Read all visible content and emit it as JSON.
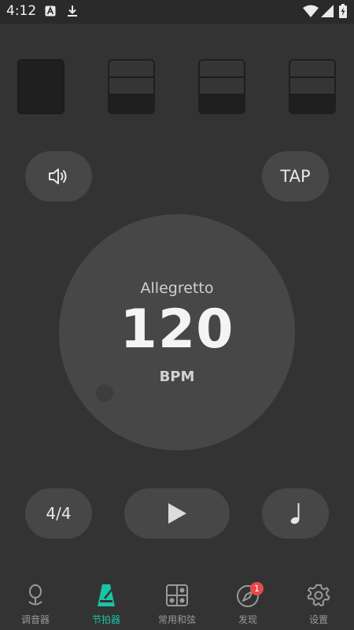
{
  "status_bar": {
    "time": "4:12",
    "icons": [
      "app-notification-icon",
      "download-icon",
      "wifi-icon",
      "cellular-signal-icon",
      "battery-charging-icon"
    ]
  },
  "beats": [
    {
      "state": "accent"
    },
    {
      "state": "normal"
    },
    {
      "state": "normal"
    },
    {
      "state": "normal"
    }
  ],
  "controls": {
    "sound_icon": "speaker-icon",
    "tap_label": "TAP",
    "time_signature": "4/4",
    "play_icon": "play-icon",
    "note_icon": "quarter-note-icon"
  },
  "dial": {
    "tempo_name": "Allegretto",
    "bpm": "120",
    "unit": "BPM"
  },
  "tab_bar": {
    "accent_color": "#19c4a3",
    "tabs": [
      {
        "label": "调音器",
        "icon": "tuner-icon",
        "active": false
      },
      {
        "label": "节拍器",
        "icon": "metronome-icon",
        "active": true
      },
      {
        "label": "常用和弦",
        "icon": "chord-grid-icon",
        "active": false
      },
      {
        "label": "发现",
        "icon": "compass-icon",
        "active": false,
        "badge": "1"
      },
      {
        "label": "设置",
        "icon": "settings-gear-icon",
        "active": false
      }
    ]
  }
}
